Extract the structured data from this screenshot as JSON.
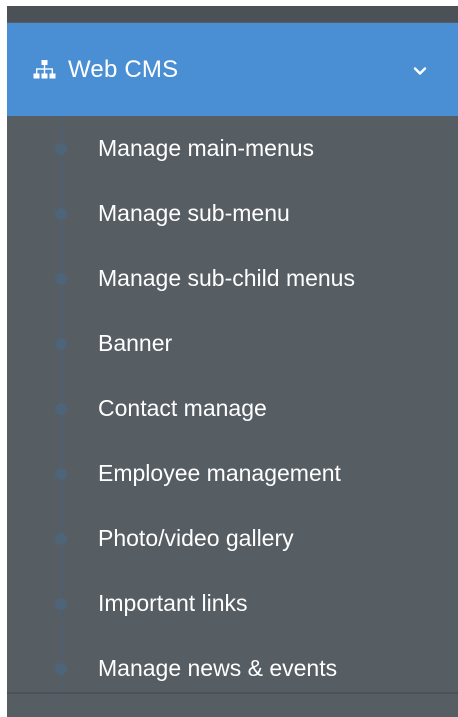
{
  "sidebar": {
    "section": {
      "title": "Web CMS",
      "icon": "sitemap-icon",
      "toggle_icon": "chevron-down-icon",
      "accent_color": "#4a8fd4"
    },
    "items": [
      {
        "label": "Manage main-menus"
      },
      {
        "label": "Manage sub-menu"
      },
      {
        "label": "Manage sub-child menus"
      },
      {
        "label": "Banner"
      },
      {
        "label": "Contact manage"
      },
      {
        "label": "Employee management"
      },
      {
        "label": "Photo/video gallery"
      },
      {
        "label": "Important links"
      },
      {
        "label": "Manage news & events"
      }
    ],
    "background_color": "#565d63",
    "text_color": "#ffffff"
  }
}
